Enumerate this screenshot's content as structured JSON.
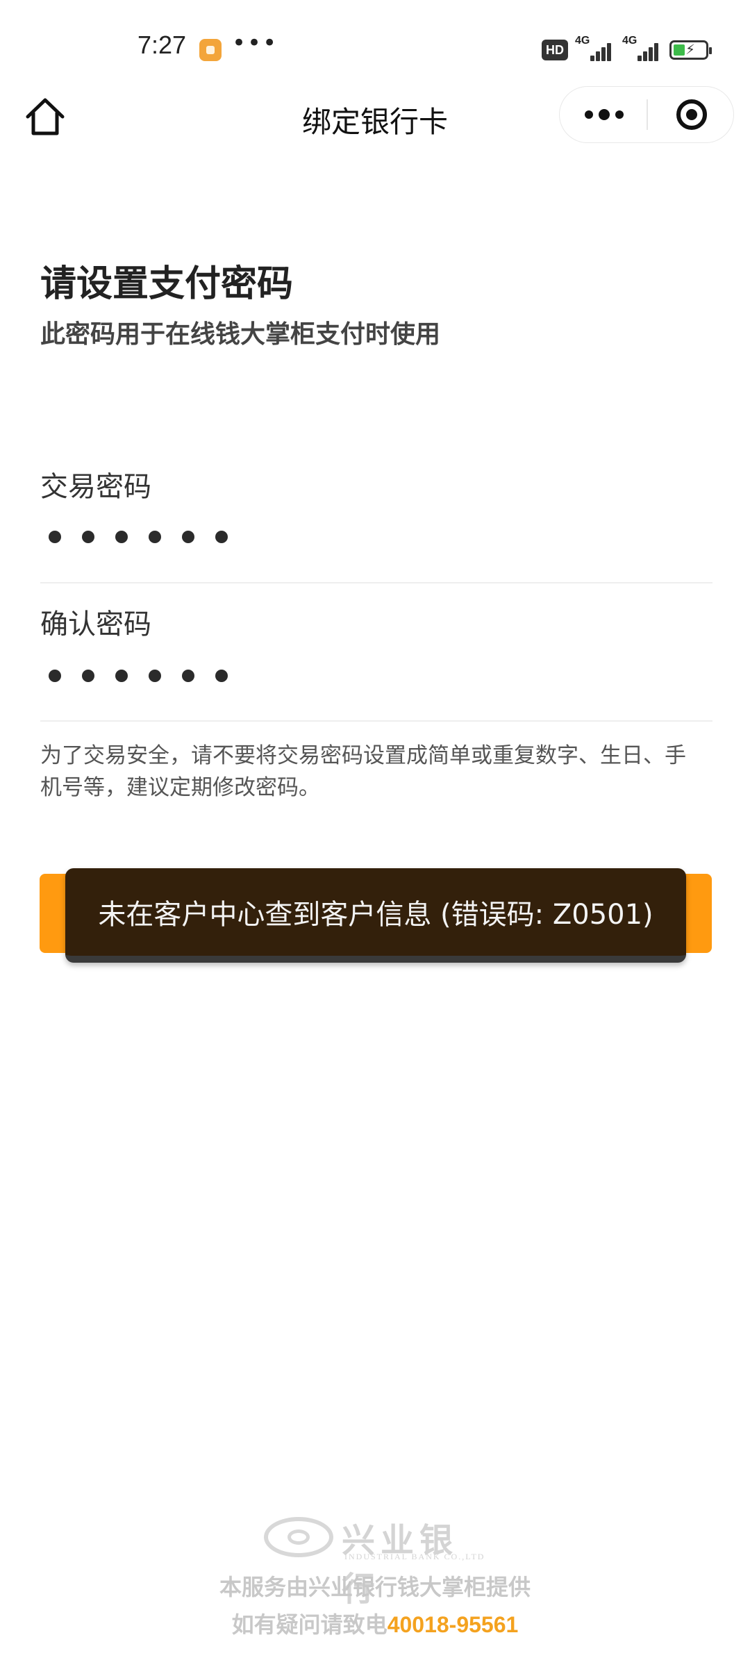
{
  "status_bar": {
    "time": "7:27",
    "more": "•••",
    "hd_badge": "HD",
    "network1": "4G",
    "network2": "4G",
    "battery_color": "#3dbb4a"
  },
  "nav": {
    "title": "绑定银行卡",
    "home_icon": "home-icon",
    "menu_icon": "more-dots-icon",
    "close_icon": "target-close-icon"
  },
  "page": {
    "heading": "请设置支付密码",
    "subheading": "此密码用于在线钱大掌柜支付时使用"
  },
  "form": {
    "trade_password_label": "交易密码",
    "confirm_password_label": "确认密码",
    "trade_password_mask": "••••••",
    "confirm_password_mask": "••••••",
    "notice": "为了交易安全，请不要将交易密码设置成简单或重复数字、生日、手机号等，建议定期修改密码。"
  },
  "submit": {
    "color": "#ff9a10"
  },
  "toast": {
    "message": "未在客户中心查到客户信息 (错误码: Z0501)"
  },
  "footer": {
    "bank_name": "兴业银行",
    "bank_name_en": "INDUSTRIAL BANK CO.,LTD",
    "provided_by": "本服务由兴业银行钱大掌柜提供",
    "hotline_prefix": "如有疑问请致电",
    "hotline_number": "40018-95561",
    "hotline_color": "#f4a21f"
  }
}
